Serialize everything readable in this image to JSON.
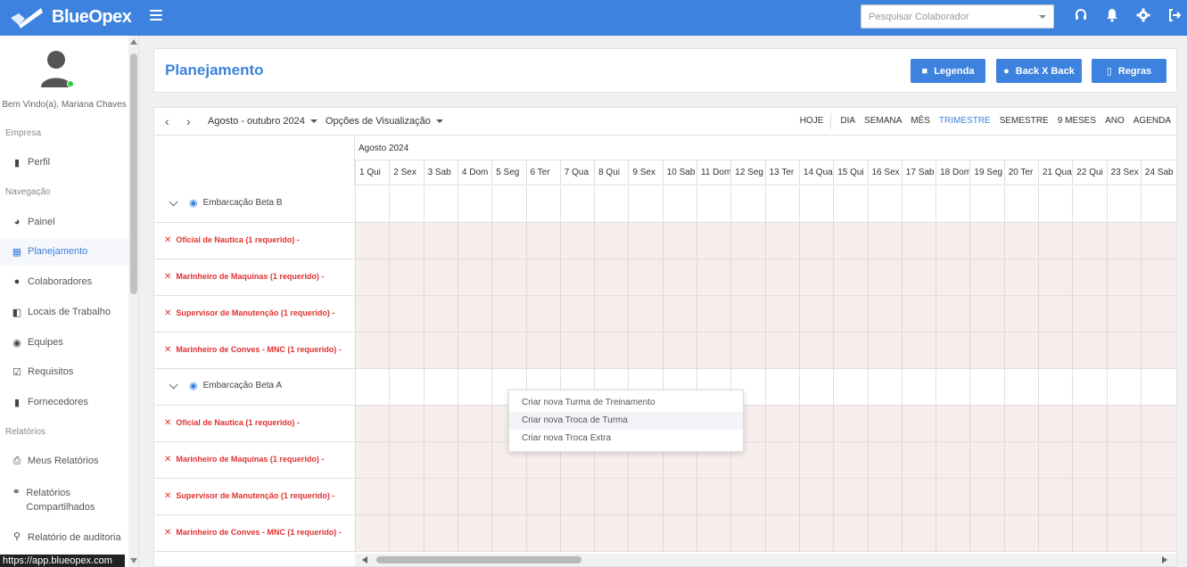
{
  "app": {
    "name": "BlueOpex"
  },
  "search": {
    "placeholder": "Pesquisar Colaborador"
  },
  "colors": {
    "primary": "#3c82de",
    "required_text": "#e03131",
    "required_bg": "#f7eded"
  },
  "topbar_icons": [
    "headset-icon",
    "bell-icon",
    "gear-icon",
    "logout-icon"
  ],
  "sidebar": {
    "welcome": "Bem Vindo(a), Mariana Chaves",
    "sections": {
      "empresa": "Empresa",
      "navegacao": "Navegação",
      "relatorios": "Relatórios"
    },
    "items": [
      {
        "label": "Perfil",
        "icon": "briefcase-icon"
      },
      {
        "label": "Painel",
        "icon": "dashboard-icon"
      },
      {
        "label": "Planejamento",
        "icon": "calendar-icon",
        "active": true
      },
      {
        "label": "Colaboradores",
        "icon": "users-icon"
      },
      {
        "label": "Locais de Trabalho",
        "icon": "building-icon"
      },
      {
        "label": "Equipes",
        "icon": "team-icon"
      },
      {
        "label": "Requisitos",
        "icon": "checkbox-icon"
      },
      {
        "label": "Fornecedores",
        "icon": "briefcase-icon"
      },
      {
        "label": "Meus Relatórios",
        "icon": "print-icon"
      },
      {
        "label": "Relatórios Compartilhados",
        "icon": "share-icon"
      },
      {
        "label": "Relatório de auditoria",
        "icon": "search-doc-icon"
      }
    ],
    "url_tooltip": "https://app.blueopex.com"
  },
  "header": {
    "title": "Planejamento",
    "buttons": {
      "legenda": "Legenda",
      "backxback": "Back X Back",
      "regras": "Regras"
    }
  },
  "toolbar": {
    "date_range": "Agosto - outubro 2024",
    "view_options": "Opções de Visualização",
    "today": "HOJE",
    "views": [
      "DIA",
      "SEMANA",
      "MÊS",
      "TRIMESTRE",
      "SEMESTRE",
      "9 MESES",
      "ANO",
      "AGENDA"
    ],
    "active_view": "TRIMESTRE"
  },
  "calendar": {
    "month": "Agosto 2024",
    "days": [
      "1 Qui",
      "2 Sex",
      "3 Sab",
      "4 Dom",
      "5 Seg",
      "6 Ter",
      "7 Qua",
      "8 Qui",
      "9 Sex",
      "10 Sab",
      "11 Dom",
      "12 Seg",
      "13 Ter",
      "14 Qua",
      "15 Qui",
      "16 Sex",
      "17 Sab",
      "18 Dom",
      "19 Seg",
      "20 Ter",
      "21 Qua",
      "22 Qui",
      "23 Sex",
      "24 Sab"
    ]
  },
  "groups": [
    {
      "name": "Embarcação Beta B",
      "requirements": [
        "Oficial de Nautica (1 requerido) -",
        "Marinheiro de Maquinas (1 requerido) -",
        "Supervisor de Manutenção (1 requerido) -",
        "Marinheiro de Conves - MNC (1 requerido) -"
      ]
    },
    {
      "name": "Embarcação Beta A",
      "requirements": [
        "Oficial de Nautica (1 requerido) -",
        "Marinheiro de Maquinas (1 requerido) -",
        "Supervisor de Manutenção (1 requerido) -",
        "Marinheiro de Conves - MNC (1 requerido) -"
      ]
    }
  ],
  "context_menu": {
    "items": [
      "Criar nova Turma de Treinamento",
      "Criar nova Troca de Turma",
      "Criar nova Troca Extra"
    ],
    "hovered": "Criar nova Troca de Turma"
  }
}
